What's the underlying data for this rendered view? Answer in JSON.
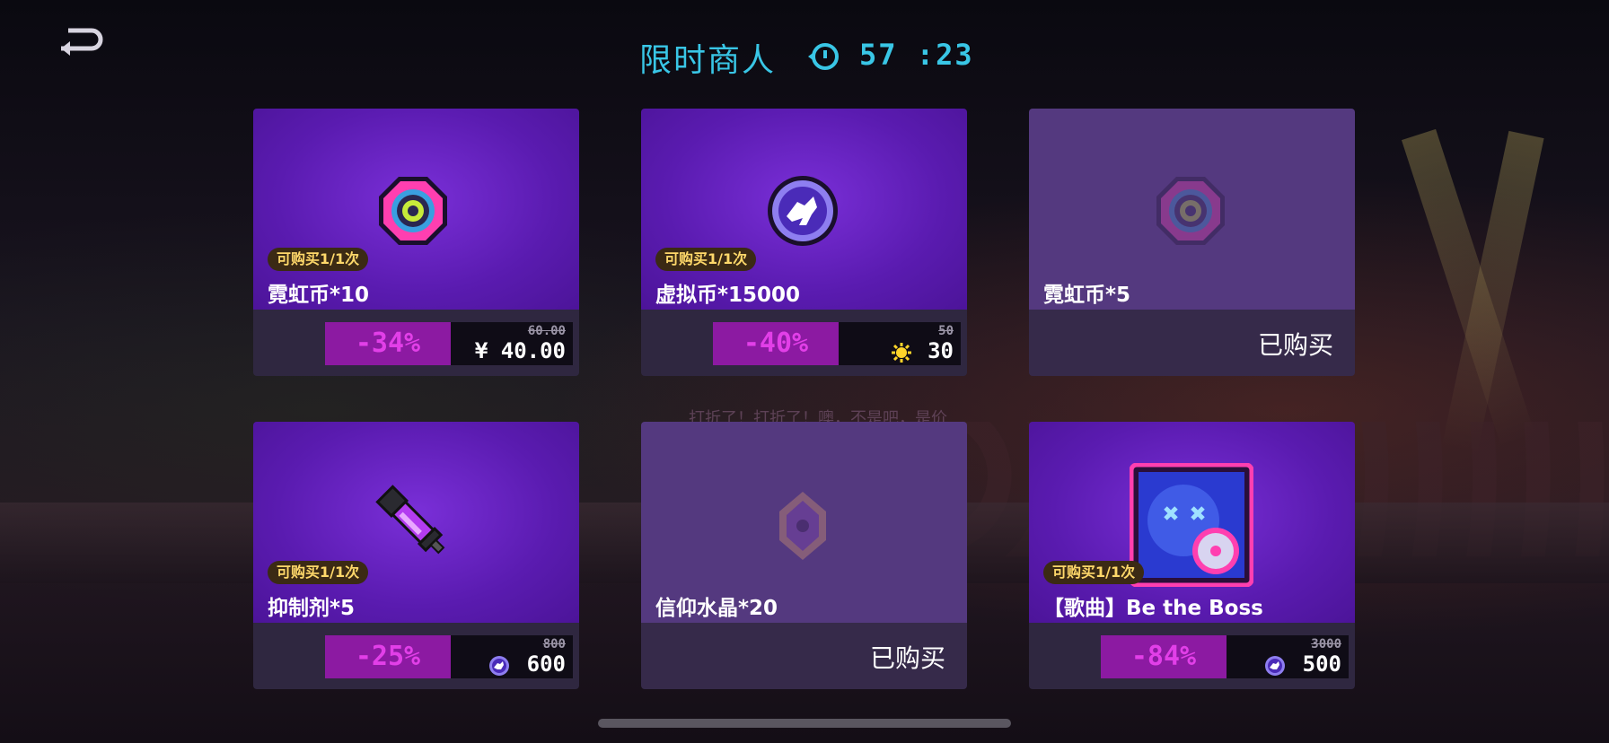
{
  "header": {
    "title": "限时商人",
    "timer": "57 :23",
    "back_icon": "back-arrow-icon",
    "timer_icon": "clock-icon"
  },
  "background": {
    "dialogue_text": "打折了！打折了！噢，不是吧，是价"
  },
  "cards": [
    {
      "name": "霓虹币*10",
      "limit": "可购买1/1次",
      "discount": "-34%",
      "old_price": "60.00",
      "currency_symbol": "¥",
      "price": "40.00",
      "icon": "neon-coin-icon",
      "sold": false
    },
    {
      "name": "虚拟币*15000",
      "limit": "可购买1/1次",
      "discount": "-40%",
      "old_price": "50",
      "price": "30",
      "icon": "virtual-coin-icon",
      "currency_icon": "sun-gem-icon",
      "sold": false
    },
    {
      "name": "霓虹币*5",
      "sold_label": "已购买",
      "icon": "neon-coin-icon",
      "sold": true
    },
    {
      "name": "抑制剂*5",
      "limit": "可购买1/1次",
      "discount": "-25%",
      "old_price": "800",
      "price": "600",
      "icon": "suppressant-icon",
      "currency_icon": "virtual-coin-icon",
      "sold": false
    },
    {
      "name": "信仰水晶*20",
      "sold_label": "已购买",
      "icon": "faith-crystal-icon",
      "sold": true
    },
    {
      "name": "【歌曲】Be the Boss",
      "limit": "可购买1/1次",
      "discount": "-84%",
      "old_price": "3000",
      "price": "500",
      "icon": "song-cover-icon",
      "currency_icon": "virtual-coin-icon",
      "sold": false
    }
  ],
  "colors": {
    "accent_cyan": "#39c6e6",
    "card_purple": "#5a1bb0",
    "discount_bg": "#8c1aa2",
    "discount_text": "#e23fe8",
    "badge_text": "#ffd86a"
  }
}
